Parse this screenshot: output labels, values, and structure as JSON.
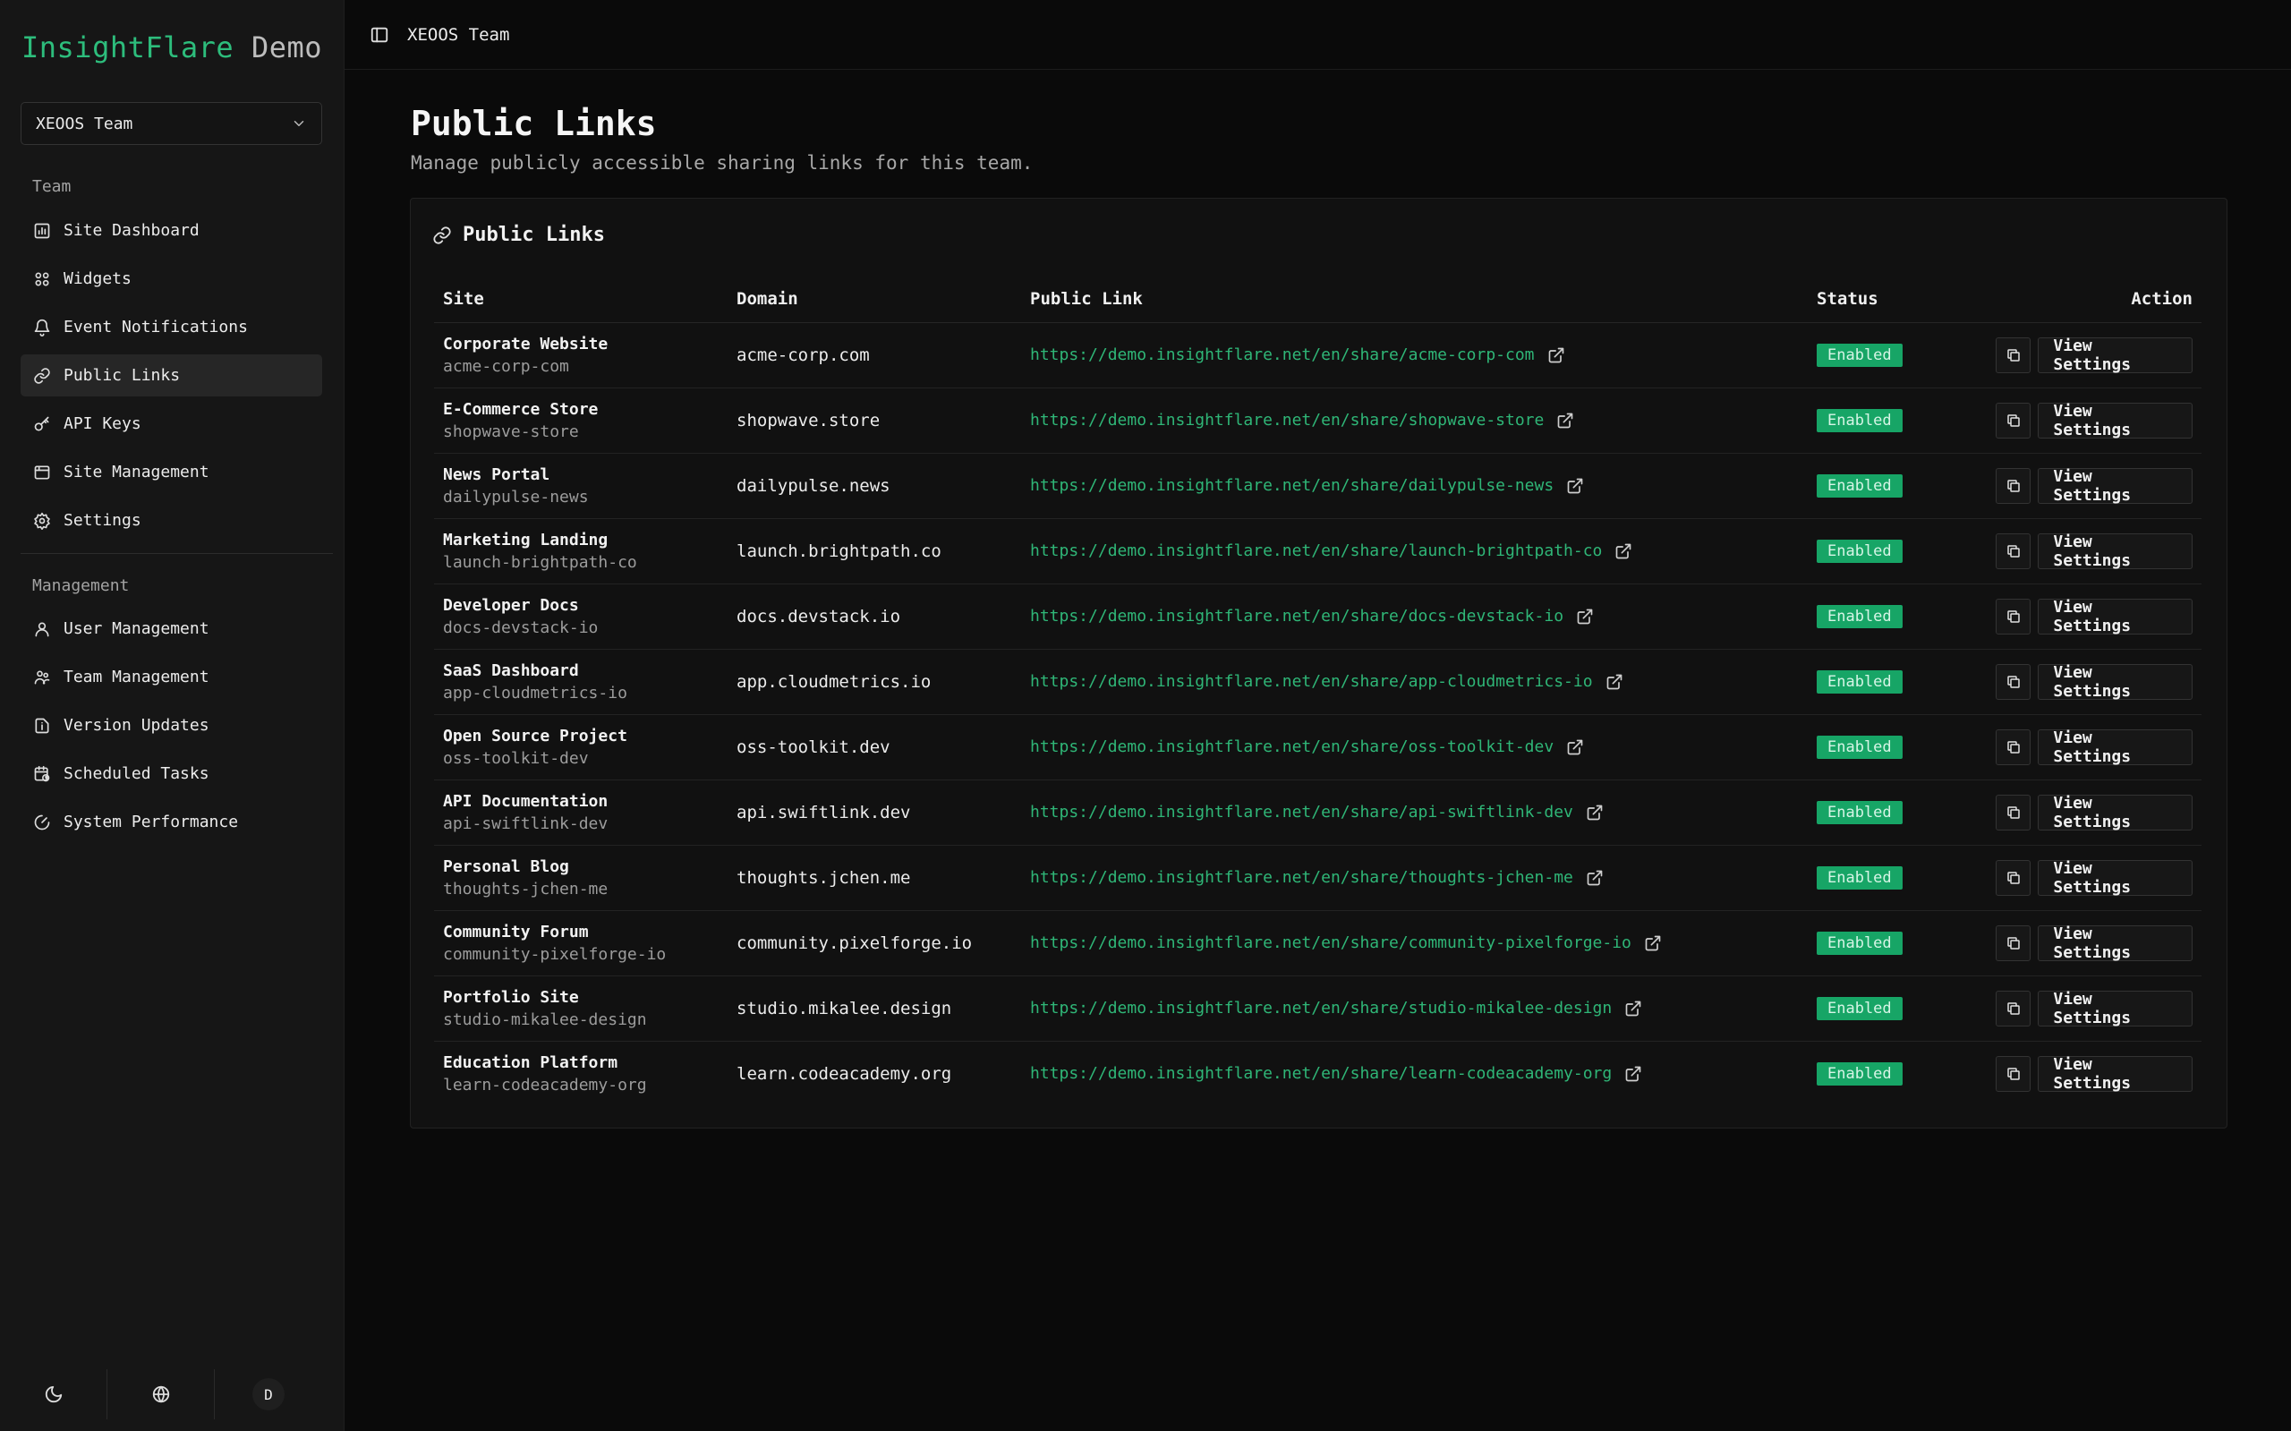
{
  "brand": {
    "name": "InsightFlare",
    "suffix": "Demo"
  },
  "team_select": {
    "value": "XEOOS Team"
  },
  "sidebar": {
    "team_label": "Team",
    "management_label": "Management",
    "team_items": [
      {
        "label": "Site Dashboard",
        "icon": "chart-icon"
      },
      {
        "label": "Widgets",
        "icon": "widgets-icon"
      },
      {
        "label": "Event Notifications",
        "icon": "bell-icon"
      },
      {
        "label": "Public Links",
        "icon": "link-icon",
        "active": true
      },
      {
        "label": "API Keys",
        "icon": "key-icon"
      },
      {
        "label": "Site Management",
        "icon": "browser-icon"
      },
      {
        "label": "Settings",
        "icon": "gear-icon"
      }
    ],
    "management_items": [
      {
        "label": "User Management",
        "icon": "user-icon"
      },
      {
        "label": "Team Management",
        "icon": "team-icon"
      },
      {
        "label": "Version Updates",
        "icon": "file-info-icon"
      },
      {
        "label": "Scheduled Tasks",
        "icon": "calendar-clock-icon"
      },
      {
        "label": "System Performance",
        "icon": "gauge-icon"
      }
    ],
    "footer": {
      "avatar_letter": "D"
    }
  },
  "topbar": {
    "title": "XEOOS Team"
  },
  "page": {
    "title": "Public Links",
    "subtitle": "Manage publicly accessible sharing links for this team."
  },
  "card": {
    "title": "Public Links"
  },
  "table": {
    "headers": {
      "site": "Site",
      "domain": "Domain",
      "link": "Public Link",
      "status": "Status",
      "action": "Action"
    },
    "view_label": "View Settings",
    "rows": [
      {
        "name": "Corporate Website",
        "slug": "acme-corp-com",
        "domain": "acme-corp.com",
        "link": "https://demo.insightflare.net/en/share/acme-corp-com",
        "status": "Enabled"
      },
      {
        "name": "E-Commerce Store",
        "slug": "shopwave-store",
        "domain": "shopwave.store",
        "link": "https://demo.insightflare.net/en/share/shopwave-store",
        "status": "Enabled"
      },
      {
        "name": "News Portal",
        "slug": "dailypulse-news",
        "domain": "dailypulse.news",
        "link": "https://demo.insightflare.net/en/share/dailypulse-news",
        "status": "Enabled"
      },
      {
        "name": "Marketing Landing",
        "slug": "launch-brightpath-co",
        "domain": "launch.brightpath.co",
        "link": "https://demo.insightflare.net/en/share/launch-brightpath-co",
        "status": "Enabled"
      },
      {
        "name": "Developer Docs",
        "slug": "docs-devstack-io",
        "domain": "docs.devstack.io",
        "link": "https://demo.insightflare.net/en/share/docs-devstack-io",
        "status": "Enabled"
      },
      {
        "name": "SaaS Dashboard",
        "slug": "app-cloudmetrics-io",
        "domain": "app.cloudmetrics.io",
        "link": "https://demo.insightflare.net/en/share/app-cloudmetrics-io",
        "status": "Enabled"
      },
      {
        "name": "Open Source Project",
        "slug": "oss-toolkit-dev",
        "domain": "oss-toolkit.dev",
        "link": "https://demo.insightflare.net/en/share/oss-toolkit-dev",
        "status": "Enabled"
      },
      {
        "name": "API Documentation",
        "slug": "api-swiftlink-dev",
        "domain": "api.swiftlink.dev",
        "link": "https://demo.insightflare.net/en/share/api-swiftlink-dev",
        "status": "Enabled"
      },
      {
        "name": "Personal Blog",
        "slug": "thoughts-jchen-me",
        "domain": "thoughts.jchen.me",
        "link": "https://demo.insightflare.net/en/share/thoughts-jchen-me",
        "status": "Enabled"
      },
      {
        "name": "Community Forum",
        "slug": "community-pixelforge-io",
        "domain": "community.pixelforge.io",
        "link": "https://demo.insightflare.net/en/share/community-pixelforge-io",
        "status": "Enabled"
      },
      {
        "name": "Portfolio Site",
        "slug": "studio-mikalee-design",
        "domain": "studio.mikalee.design",
        "link": "https://demo.insightflare.net/en/share/studio-mikalee-design",
        "status": "Enabled"
      },
      {
        "name": "Education Platform",
        "slug": "learn-codeacademy-org",
        "domain": "learn.codeacademy.org",
        "link": "https://demo.insightflare.net/en/share/learn-codeacademy-org",
        "status": "Enabled"
      }
    ]
  },
  "colors": {
    "accent": "#2dbd7c",
    "badge": "#17a566",
    "background": "#0a0a0a",
    "sidebar": "#161616"
  }
}
